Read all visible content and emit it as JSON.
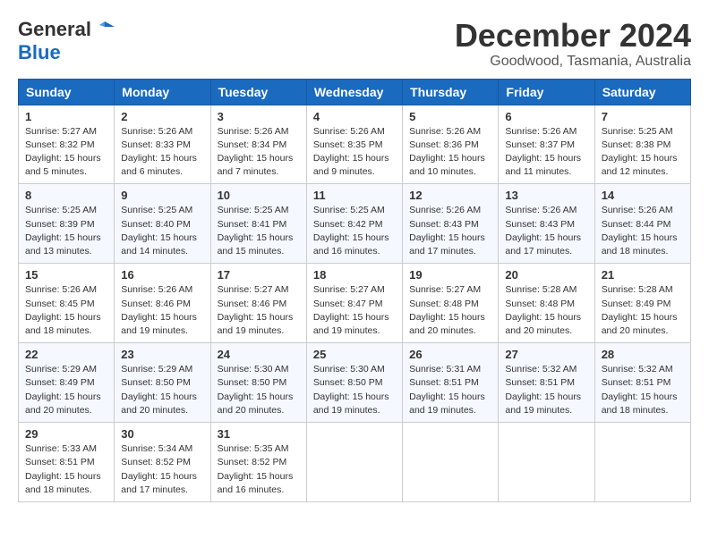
{
  "logo": {
    "line1": "General",
    "line2": "Blue"
  },
  "title": "December 2024",
  "location": "Goodwood, Tasmania, Australia",
  "headers": [
    "Sunday",
    "Monday",
    "Tuesday",
    "Wednesday",
    "Thursday",
    "Friday",
    "Saturday"
  ],
  "weeks": [
    [
      {
        "day": "1",
        "sunrise": "5:27 AM",
        "sunset": "8:32 PM",
        "daylight": "15 hours and 5 minutes."
      },
      {
        "day": "2",
        "sunrise": "5:26 AM",
        "sunset": "8:33 PM",
        "daylight": "15 hours and 6 minutes."
      },
      {
        "day": "3",
        "sunrise": "5:26 AM",
        "sunset": "8:34 PM",
        "daylight": "15 hours and 7 minutes."
      },
      {
        "day": "4",
        "sunrise": "5:26 AM",
        "sunset": "8:35 PM",
        "daylight": "15 hours and 9 minutes."
      },
      {
        "day": "5",
        "sunrise": "5:26 AM",
        "sunset": "8:36 PM",
        "daylight": "15 hours and 10 minutes."
      },
      {
        "day": "6",
        "sunrise": "5:26 AM",
        "sunset": "8:37 PM",
        "daylight": "15 hours and 11 minutes."
      },
      {
        "day": "7",
        "sunrise": "5:25 AM",
        "sunset": "8:38 PM",
        "daylight": "15 hours and 12 minutes."
      }
    ],
    [
      {
        "day": "8",
        "sunrise": "5:25 AM",
        "sunset": "8:39 PM",
        "daylight": "15 hours and 13 minutes."
      },
      {
        "day": "9",
        "sunrise": "5:25 AM",
        "sunset": "8:40 PM",
        "daylight": "15 hours and 14 minutes."
      },
      {
        "day": "10",
        "sunrise": "5:25 AM",
        "sunset": "8:41 PM",
        "daylight": "15 hours and 15 minutes."
      },
      {
        "day": "11",
        "sunrise": "5:25 AM",
        "sunset": "8:42 PM",
        "daylight": "15 hours and 16 minutes."
      },
      {
        "day": "12",
        "sunrise": "5:26 AM",
        "sunset": "8:43 PM",
        "daylight": "15 hours and 17 minutes."
      },
      {
        "day": "13",
        "sunrise": "5:26 AM",
        "sunset": "8:43 PM",
        "daylight": "15 hours and 17 minutes."
      },
      {
        "day": "14",
        "sunrise": "5:26 AM",
        "sunset": "8:44 PM",
        "daylight": "15 hours and 18 minutes."
      }
    ],
    [
      {
        "day": "15",
        "sunrise": "5:26 AM",
        "sunset": "8:45 PM",
        "daylight": "15 hours and 18 minutes."
      },
      {
        "day": "16",
        "sunrise": "5:26 AM",
        "sunset": "8:46 PM",
        "daylight": "15 hours and 19 minutes."
      },
      {
        "day": "17",
        "sunrise": "5:27 AM",
        "sunset": "8:46 PM",
        "daylight": "15 hours and 19 minutes."
      },
      {
        "day": "18",
        "sunrise": "5:27 AM",
        "sunset": "8:47 PM",
        "daylight": "15 hours and 19 minutes."
      },
      {
        "day": "19",
        "sunrise": "5:27 AM",
        "sunset": "8:48 PM",
        "daylight": "15 hours and 20 minutes."
      },
      {
        "day": "20",
        "sunrise": "5:28 AM",
        "sunset": "8:48 PM",
        "daylight": "15 hours and 20 minutes."
      },
      {
        "day": "21",
        "sunrise": "5:28 AM",
        "sunset": "8:49 PM",
        "daylight": "15 hours and 20 minutes."
      }
    ],
    [
      {
        "day": "22",
        "sunrise": "5:29 AM",
        "sunset": "8:49 PM",
        "daylight": "15 hours and 20 minutes."
      },
      {
        "day": "23",
        "sunrise": "5:29 AM",
        "sunset": "8:50 PM",
        "daylight": "15 hours and 20 minutes."
      },
      {
        "day": "24",
        "sunrise": "5:30 AM",
        "sunset": "8:50 PM",
        "daylight": "15 hours and 20 minutes."
      },
      {
        "day": "25",
        "sunrise": "5:30 AM",
        "sunset": "8:50 PM",
        "daylight": "15 hours and 19 minutes."
      },
      {
        "day": "26",
        "sunrise": "5:31 AM",
        "sunset": "8:51 PM",
        "daylight": "15 hours and 19 minutes."
      },
      {
        "day": "27",
        "sunrise": "5:32 AM",
        "sunset": "8:51 PM",
        "daylight": "15 hours and 19 minutes."
      },
      {
        "day": "28",
        "sunrise": "5:32 AM",
        "sunset": "8:51 PM",
        "daylight": "15 hours and 18 minutes."
      }
    ],
    [
      {
        "day": "29",
        "sunrise": "5:33 AM",
        "sunset": "8:51 PM",
        "daylight": "15 hours and 18 minutes."
      },
      {
        "day": "30",
        "sunrise": "5:34 AM",
        "sunset": "8:52 PM",
        "daylight": "15 hours and 17 minutes."
      },
      {
        "day": "31",
        "sunrise": "5:35 AM",
        "sunset": "8:52 PM",
        "daylight": "15 hours and 16 minutes."
      },
      null,
      null,
      null,
      null
    ]
  ],
  "labels": {
    "sunrise": "Sunrise:",
    "sunset": "Sunset:",
    "daylight": "Daylight:"
  }
}
